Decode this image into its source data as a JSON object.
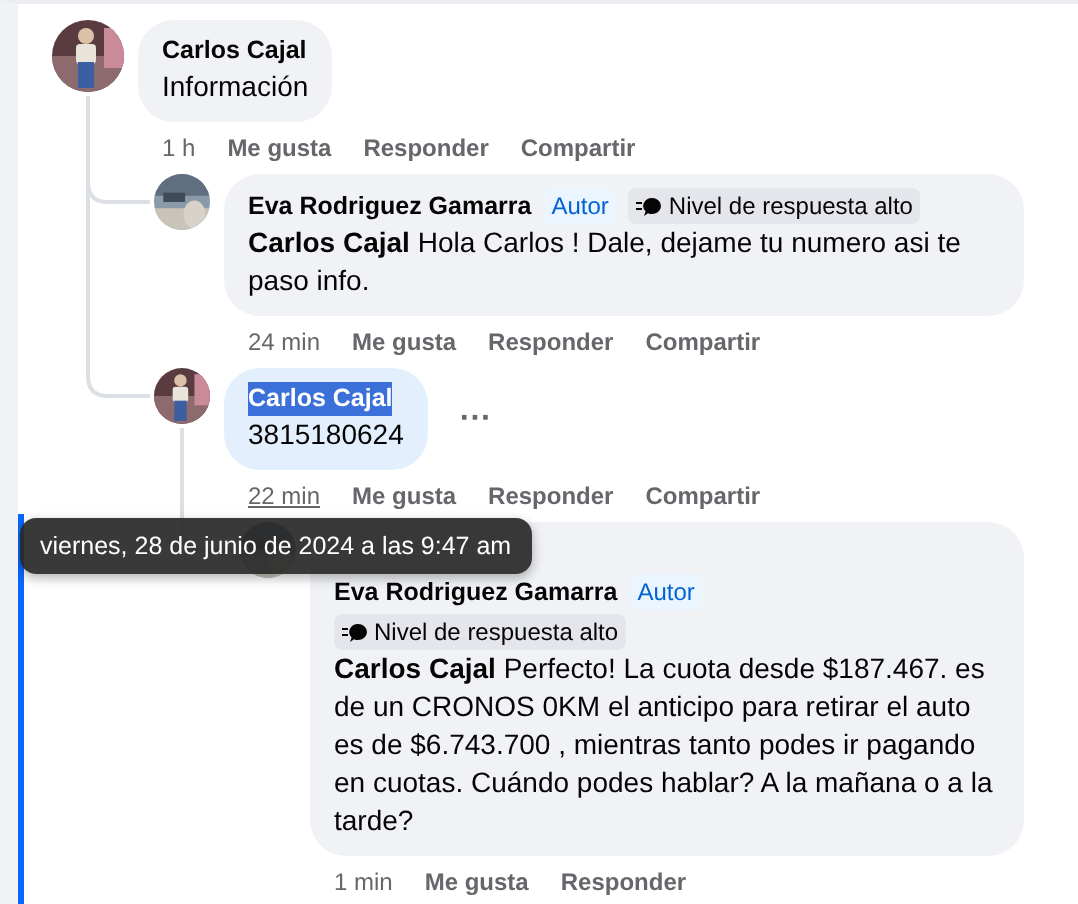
{
  "comments": [
    {
      "author": "Carlos Cajal",
      "text": "Información",
      "time": "1 h",
      "time_hovered": false,
      "actions": [
        "Me gusta",
        "Responder",
        "Compartir"
      ],
      "replies": [
        {
          "author": "Eva Rodriguez Gamarra",
          "badges": [
            {
              "kind": "author",
              "label": "Autor"
            },
            {
              "kind": "responder",
              "label": "Nivel de respuesta alto"
            }
          ],
          "mention": "Carlos Cajal",
          "text": "Hola Carlos ! Dale, dejame tu numero asi te paso info.",
          "time": "24 min",
          "time_hovered": false,
          "actions": [
            "Me gusta",
            "Responder",
            "Compartir"
          ]
        },
        {
          "author": "Carlos Cajal",
          "author_selected": true,
          "highlighted": true,
          "more_button": "···",
          "text": "3815180624",
          "time": "22 min",
          "time_hovered": true,
          "tooltip": "viernes, 28 de junio de 2024 a las 9:47 am",
          "actions": [
            "Me gusta",
            "Responder",
            "Compartir"
          ],
          "replies": [
            {
              "author": "Eva Rodriguez Gamarra",
              "focused": true,
              "badges": [
                {
                  "kind": "author",
                  "label": "Autor"
                },
                {
                  "kind": "responder",
                  "label": "Nivel de respuesta alto"
                }
              ],
              "mention": "Carlos Cajal",
              "text": "Perfecto! La cuota desde $187.467. es de un CRONOS 0KM el anticipo para retirar el auto es de $6.743.700 , mientras tanto podes ir pagando en cuotas. Cuándo podes hablar? A la mañana o a la tarde?",
              "time": "1 min",
              "time_hovered": false,
              "actions": [
                "Me gusta",
                "Responder"
              ]
            }
          ]
        }
      ]
    }
  ]
}
